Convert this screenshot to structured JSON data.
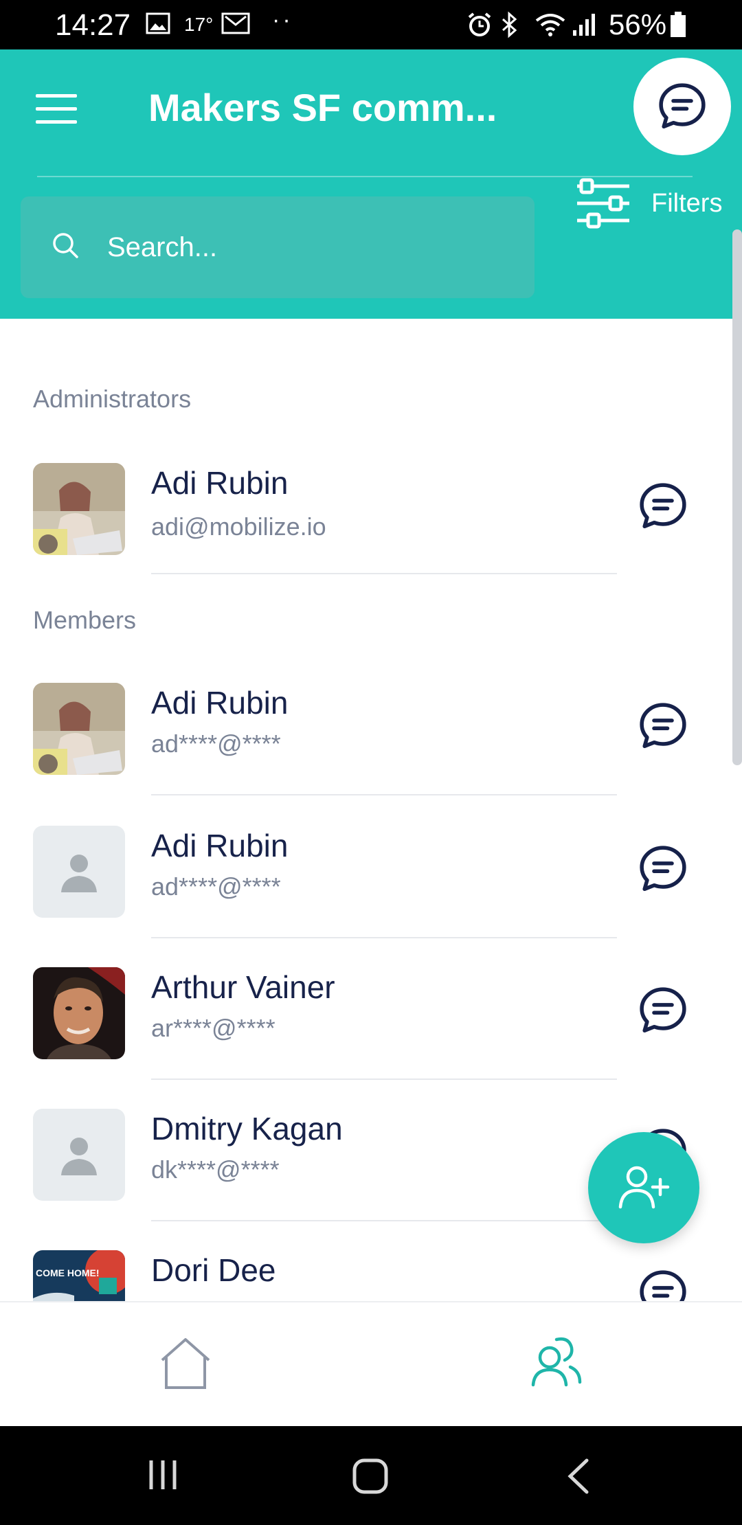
{
  "status_bar": {
    "time": "14:27",
    "temperature": "17°",
    "more_dots": "··",
    "battery": "56%"
  },
  "header": {
    "title": "Makers SF comm...",
    "search_placeholder": "Search...",
    "filters_label": "Filters"
  },
  "sections": {
    "administrators": {
      "label": "Administrators",
      "items": [
        {
          "name": "Adi Rubin",
          "email": "adi@mobilize.io",
          "avatar": "photo-woman-laptop"
        }
      ]
    },
    "members": {
      "label": "Members",
      "items": [
        {
          "name": "Adi Rubin",
          "email": "ad****@****",
          "avatar": "photo-woman-laptop"
        },
        {
          "name": "Adi Rubin",
          "email": "ad****@****",
          "avatar": "placeholder-person-icon"
        },
        {
          "name": "Arthur Vainer",
          "email": "ar****@****",
          "avatar": "photo-man"
        },
        {
          "name": "Dmitry Kagan",
          "email": "dk****@****",
          "avatar": "placeholder-person-icon"
        },
        {
          "name": "Dori Dee",
          "email": "",
          "avatar": "photo-come-home-banner"
        }
      ]
    }
  },
  "colors": {
    "accent": "#1fc6b8",
    "text_primary": "#17224a",
    "text_secondary": "#7a8396"
  },
  "bottom_nav": {
    "items": [
      "home-icon",
      "members-icon"
    ],
    "active": "members-icon"
  }
}
